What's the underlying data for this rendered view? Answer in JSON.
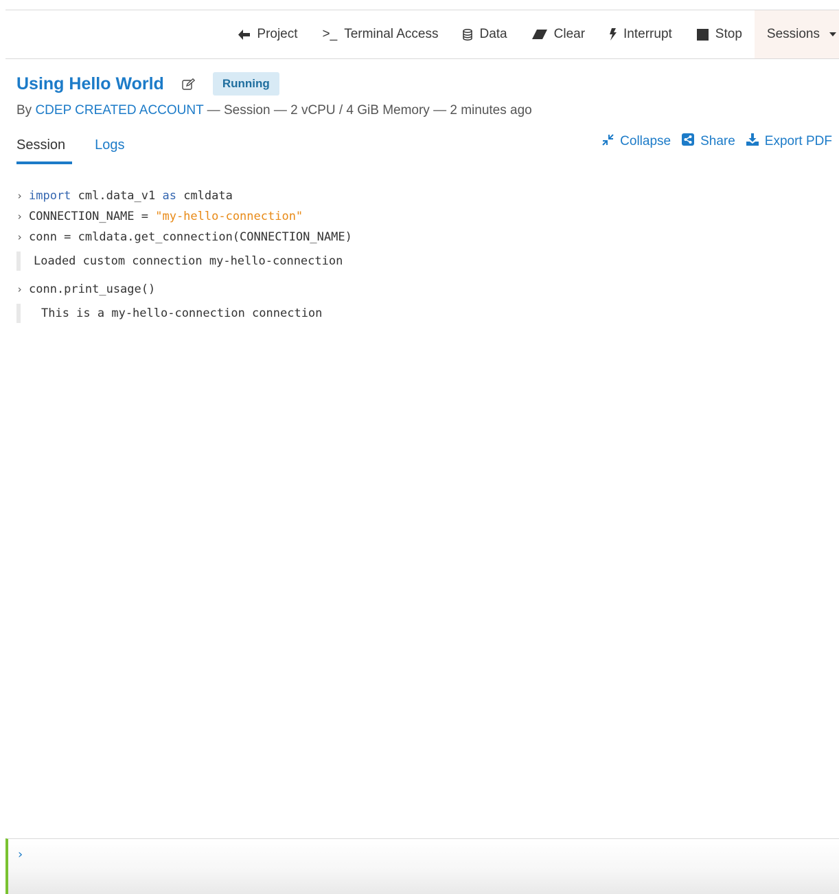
{
  "toolbar": {
    "project": "Project",
    "terminal_prefix": ">_",
    "terminal": "Terminal Access",
    "data": "Data",
    "clear": "Clear",
    "interrupt": "Interrupt",
    "stop": "Stop",
    "sessions": "Sessions"
  },
  "header": {
    "title": "Using Hello World",
    "status": "Running",
    "by_prefix": "By ",
    "owner": "CDEP CREATED ACCOUNT",
    "details": " — Session — 2 vCPU / 4 GiB Memory — 2 minutes ago"
  },
  "tabs": [
    {
      "label": "Session"
    },
    {
      "label": "Logs"
    }
  ],
  "actions": {
    "collapse": "Collapse",
    "share": "Share",
    "export": "Export PDF"
  },
  "console": {
    "line1": {
      "kw1": "import",
      "mid": " cml.data_v1 ",
      "kw2": "as",
      "end": " cmldata"
    },
    "line2": {
      "start": "CONNECTION_NAME = ",
      "str": "\"my-hello-connection\""
    },
    "line3": "conn = cmldata.get_connection(CONNECTION_NAME)",
    "output1": "Loaded custom connection my-hello-connection",
    "line4": "conn.print_usage()",
    "output2": "This is a my-hello-connection connection"
  },
  "input": {
    "prompt": "›"
  },
  "colors": {
    "link": "#1c7bc8",
    "status_bg": "#d8eaf5",
    "keyword": "#3466b0",
    "string": "#e88a17",
    "input_accent": "#7ac231"
  }
}
